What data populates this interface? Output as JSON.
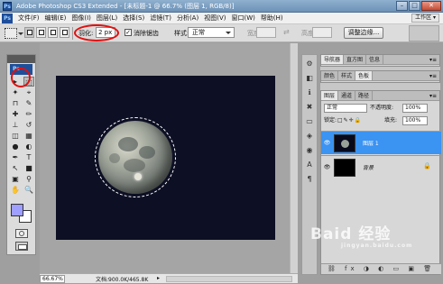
{
  "window": {
    "title": "Adobe Photoshop CS3 Extended - [未标题-1 @ 66.7% (图层 1, RGB/8)]",
    "app_logo": "Ps",
    "controls": {
      "minimize": "–",
      "maximize": "□",
      "close": "✕"
    }
  },
  "menubar": {
    "items": [
      "文件(F)",
      "编辑(E)",
      "图像(I)",
      "图层(L)",
      "选择(S)",
      "滤镜(T)",
      "分析(A)",
      "视图(V)",
      "窗口(W)",
      "帮助(H)"
    ],
    "workspace": "工作区 ▾"
  },
  "options": {
    "feather_label": "羽化:",
    "feather_value": "2 px",
    "antialias_label": "消除锯齿",
    "antialias_checked": "✓",
    "style_label": "样式:",
    "style_value": "正常",
    "width_label": "宽度:",
    "height_label": "高度:",
    "swap_icon": "⇄",
    "refine_edge": "调整边缘..."
  },
  "toolbox": {
    "logo": "Ps",
    "tools": [
      {
        "glyph": "▸",
        "icon": "move-tool-icon"
      },
      {
        "glyph": "⬚",
        "icon": "marquee-tool-icon"
      },
      {
        "glyph": "✦",
        "icon": "magic-wand-icon"
      },
      {
        "glyph": "⌖",
        "icon": "lasso-icon"
      },
      {
        "glyph": "⊓",
        "icon": "crop-icon"
      },
      {
        "glyph": "✎",
        "icon": "slice-icon"
      },
      {
        "glyph": "✚",
        "icon": "healing-brush-icon"
      },
      {
        "glyph": "✏",
        "icon": "brush-icon"
      },
      {
        "glyph": "⊥",
        "icon": "clone-stamp-icon"
      },
      {
        "glyph": "↺",
        "icon": "history-brush-icon"
      },
      {
        "glyph": "◫",
        "icon": "eraser-icon"
      },
      {
        "glyph": "▦",
        "icon": "gradient-icon"
      },
      {
        "glyph": "●",
        "icon": "blur-icon"
      },
      {
        "glyph": "◐",
        "icon": "dodge-icon"
      },
      {
        "glyph": "✒",
        "icon": "pen-icon"
      },
      {
        "glyph": "T",
        "icon": "type-tool-icon"
      },
      {
        "glyph": "↖",
        "icon": "path-selection-icon"
      },
      {
        "glyph": "■",
        "icon": "shape-tool-icon"
      },
      {
        "glyph": "▣",
        "icon": "notes-icon"
      },
      {
        "glyph": "⚲",
        "icon": "eyedropper-icon"
      },
      {
        "glyph": "✋",
        "icon": "hand-tool-icon"
      },
      {
        "glyph": "🔍",
        "icon": "zoom-tool-icon"
      }
    ],
    "foreground_color": "#9f9fff",
    "background_color": "#ffffff"
  },
  "status": {
    "zoom": "66.67%",
    "doc_size": "文档:900.0K/465.8K",
    "arrow": "▸"
  },
  "dock_icons": [
    {
      "glyph": "⚙",
      "icon": "navigator-icon"
    },
    {
      "glyph": "◧",
      "icon": "histogram-icon"
    },
    {
      "glyph": "ℹ",
      "icon": "info-icon"
    },
    {
      "glyph": "✖",
      "icon": "tools-preset-icon"
    },
    {
      "glyph": "▭",
      "icon": "brushes-icon"
    },
    {
      "glyph": "◈",
      "icon": "clone-source-icon"
    },
    {
      "glyph": "◉",
      "icon": "layer-comps-icon"
    },
    {
      "glyph": "A",
      "icon": "character-icon"
    },
    {
      "glyph": "¶",
      "icon": "paragraph-icon"
    }
  ],
  "panels": {
    "group1": {
      "tabs": [
        "导航器",
        "直方图",
        "信息"
      ],
      "menu": "▾≡"
    },
    "group2": {
      "tabs": [
        "颜色",
        "样式",
        "色板"
      ],
      "active": 2,
      "menu": "▾≡"
    },
    "layers": {
      "tabs": [
        "图层",
        "通道",
        "路径"
      ],
      "menu": "▾≡",
      "blend_mode": "正常",
      "opacity_label": "不透明度:",
      "opacity_value": "100%",
      "lock_label": "锁定:",
      "lock_icons": "□✎✛🔒",
      "fill_label": "填充:",
      "fill_value": "100%",
      "eye": "👁",
      "items": [
        {
          "name": "图层 1",
          "selected": true
        },
        {
          "name": "背景",
          "lock": "🔒"
        }
      ],
      "footer": "⛓ fx ◑ ◐ ▭ ▣ 🗑"
    }
  },
  "watermark": {
    "text": "Baid 经验",
    "url": "jingyan.baidu.com"
  },
  "annotation_color": "#e01010"
}
